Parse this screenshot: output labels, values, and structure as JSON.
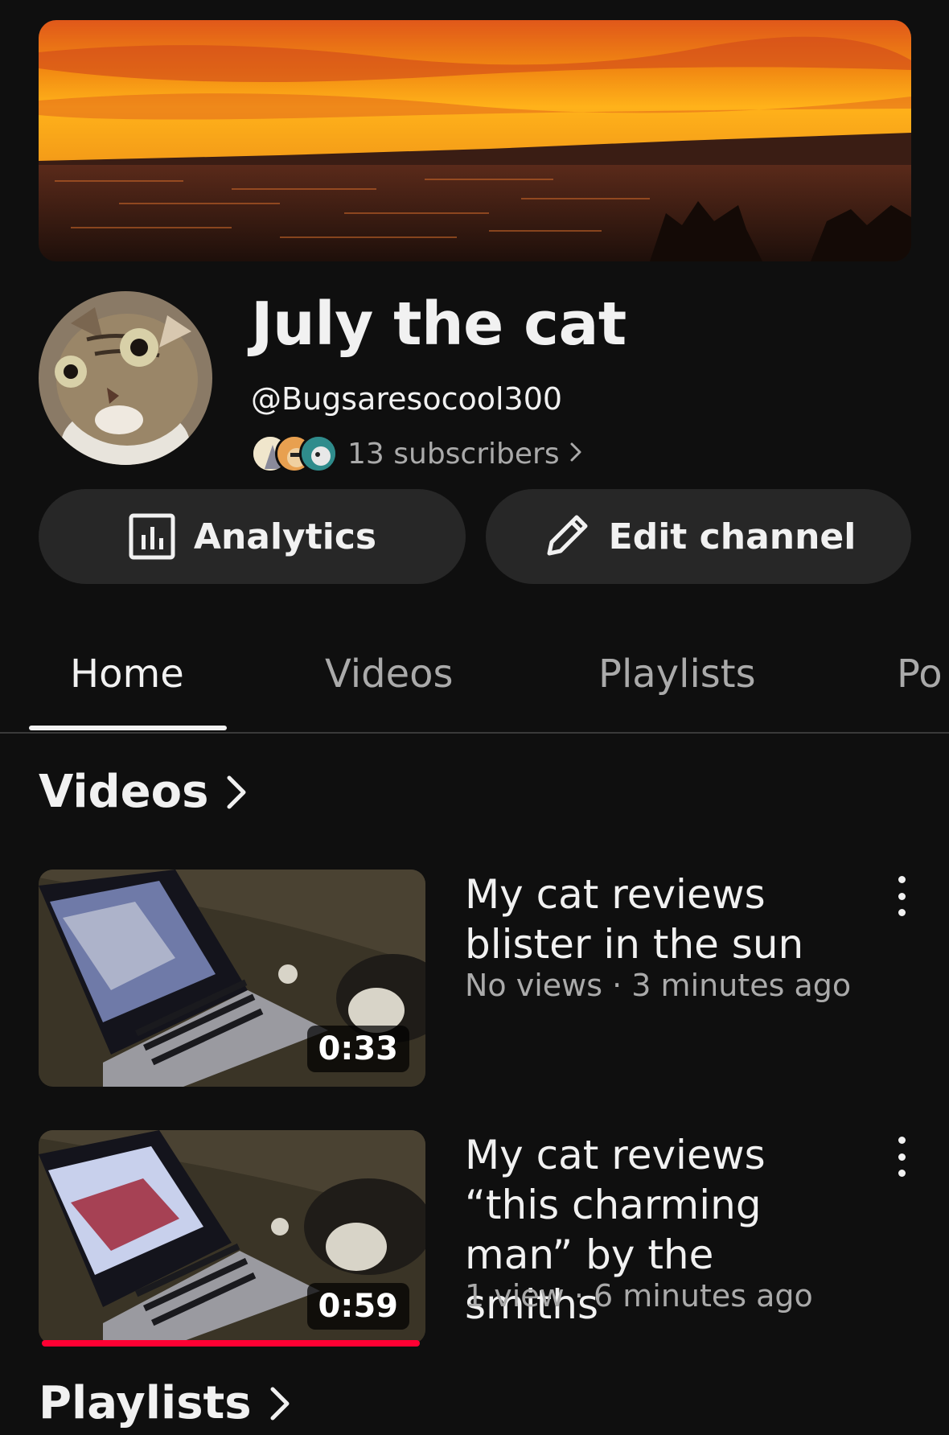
{
  "channel": {
    "name": "July the cat",
    "handle": "@Bugsaresocool300",
    "subscribers": "13 subscribers"
  },
  "actions": {
    "analytics_label": "Analytics",
    "edit_label": "Edit channel"
  },
  "tabs": [
    {
      "label": "Home",
      "active": true
    },
    {
      "label": "Videos",
      "active": false
    },
    {
      "label": "Playlists",
      "active": false
    },
    {
      "label": "Po",
      "active": false
    }
  ],
  "sections": {
    "videos_title": "Videos",
    "playlists_title": "Playlists"
  },
  "videos": [
    {
      "title": "My cat reviews blister in the sun",
      "meta": "No views · 3 minutes ago",
      "duration": "0:33",
      "watched_fraction": 0
    },
    {
      "title": "My cat reviews “this charming man” by the smiths",
      "meta": "1 view · 6 minutes ago",
      "duration": "0:59",
      "watched_fraction": 1
    }
  ],
  "icons": {
    "analytics": "bar-chart-icon",
    "edit": "pencil-icon",
    "more": "kebab-menu-icon",
    "chevron": "chevron-right-icon"
  },
  "colors": {
    "background": "#0f0f0f",
    "button": "#272727",
    "progress": "#ff0033",
    "secondary_text": "#aaaaaa"
  }
}
